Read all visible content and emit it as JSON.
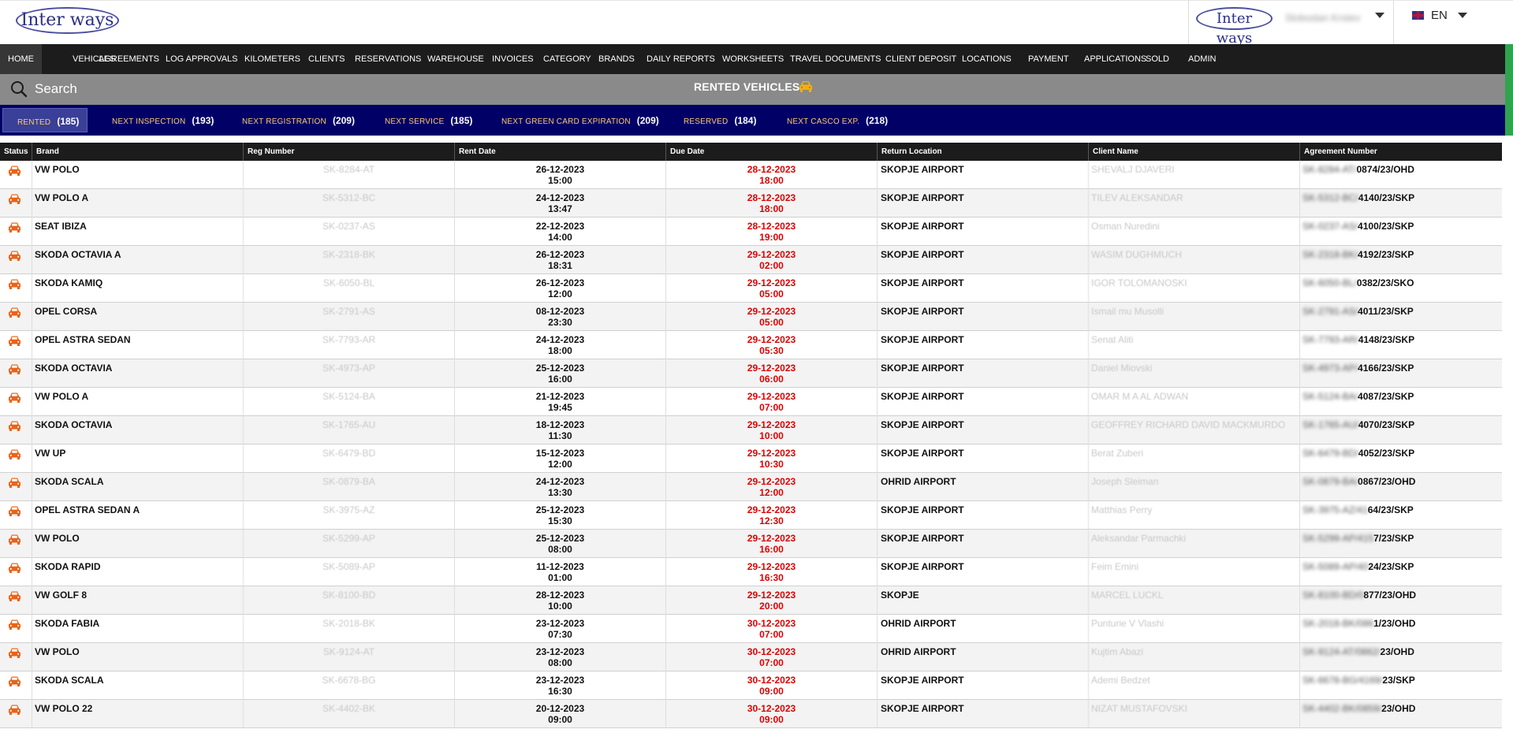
{
  "header": {
    "logo_text": "Inter ways",
    "small_logo_text": "Inter ways",
    "user_name": "Slobodan Krstev",
    "language": "EN"
  },
  "colors": {
    "nav_background": "#1c1c1c",
    "search_bar_background": "#8a8a8a",
    "tabs_background": "#000066",
    "tab_label_color": "#ffcc66",
    "due_date_color": "#dd0000",
    "status_icon_color": "#e8631a",
    "accent_strip": "#2ea44f"
  },
  "nav": {
    "items": [
      {
        "label": "HOME",
        "active": true
      },
      {
        "label": "VEHICLES"
      },
      {
        "label": "AGREEMENTS"
      },
      {
        "label": "LOG APPROVALS"
      },
      {
        "label": "KILOMETERS"
      },
      {
        "label": "CLIENTS"
      },
      {
        "label": "RESERVATIONS"
      },
      {
        "label": "WAREHOUSE"
      },
      {
        "label": "INVOICES"
      },
      {
        "label": "CATEGORY"
      },
      {
        "label": "BRANDS"
      },
      {
        "label": "DAILY REPORTS"
      },
      {
        "label": "WORKSHEETS"
      },
      {
        "label": "TRAVEL DOCUMENTS"
      },
      {
        "label": "CLIENT DEPOSIT"
      },
      {
        "label": "LOCATIONS"
      },
      {
        "label": "PAYMENT"
      },
      {
        "label": "APPLICATIONS"
      },
      {
        "label": "SOLD"
      },
      {
        "label": "ADMIN"
      }
    ]
  },
  "search": {
    "placeholder": "Search",
    "page_title": "RENTED VEHICLES",
    "title_icon": "car-icon"
  },
  "tabs": [
    {
      "label": "RENTED",
      "count": "(185)",
      "active": true
    },
    {
      "label": "NEXT INSPECTION",
      "count": "(193)"
    },
    {
      "label": "NEXT REGISTRATION",
      "count": "(209)"
    },
    {
      "label": "NEXT SERVICE",
      "count": "(185)"
    },
    {
      "label": "NEXT GREEN CARD EXPIRATION",
      "count": "(209)"
    },
    {
      "label": "RESERVED",
      "count": "(184)"
    },
    {
      "label": "NEXT CASCO EXP.",
      "count": "(218)"
    }
  ],
  "table": {
    "columns": [
      "Status",
      "Brand",
      "Reg Number",
      "Rent Date",
      "Due Date",
      "Return Location",
      "Client Name",
      "Agreement Number"
    ],
    "status_icon": "car-icon",
    "rows": [
      {
        "brand": "VW POLO",
        "reg": "SK-8284-AT",
        "rent_date": "26-12-2023",
        "rent_time": "15:00",
        "due_date": "28-12-2023",
        "due_time": "18:00",
        "location": "SKOPJE AIRPORT",
        "client": "SHEVALJ DJAVERI",
        "agr_hidden": "SK-8284-AT/",
        "agr_visible": "0874/23/OHD"
      },
      {
        "brand": "VW POLO A",
        "reg": "SK-5312-BC",
        "rent_date": "24-12-2023",
        "rent_time": "13:47",
        "due_date": "28-12-2023",
        "due_time": "18:00",
        "location": "SKOPJE AIRPORT",
        "client": "TILEV ALEKSANDAR",
        "agr_hidden": "SK-5312-BC/",
        "agr_visible": "4140/23/SKP"
      },
      {
        "brand": "SEAT IBIZA",
        "reg": "SK-0237-AS",
        "rent_date": "22-12-2023",
        "rent_time": "14:00",
        "due_date": "28-12-2023",
        "due_time": "19:00",
        "location": "SKOPJE AIRPORT",
        "client": "Osman Nuredini",
        "agr_hidden": "SK-0237-AS/",
        "agr_visible": "4100/23/SKP"
      },
      {
        "brand": "SKODA OCTAVIA A",
        "reg": "SK-2318-BK",
        "rent_date": "26-12-2023",
        "rent_time": "18:31",
        "due_date": "29-12-2023",
        "due_time": "02:00",
        "location": "SKOPJE AIRPORT",
        "client": "WASIM DUGHMUCH",
        "agr_hidden": "SK-2318-BK/",
        "agr_visible": "4192/23/SKP"
      },
      {
        "brand": "SKODA KAMIQ",
        "reg": "SK-6050-BL",
        "rent_date": "26-12-2023",
        "rent_time": "12:00",
        "due_date": "29-12-2023",
        "due_time": "05:00",
        "location": "SKOPJE AIRPORT",
        "client": "IGOR TOLOMANOSKI",
        "agr_hidden": "SK-6050-BL/",
        "agr_visible": "0382/23/SKO"
      },
      {
        "brand": "OPEL CORSA",
        "reg": "SK-2791-AS",
        "rent_date": "08-12-2023",
        "rent_time": "23:30",
        "due_date": "29-12-2023",
        "due_time": "05:00",
        "location": "SKOPJE AIRPORT",
        "client": "Ismail mu Musolli",
        "agr_hidden": "SK-2791-AS/",
        "agr_visible": "4011/23/SKP"
      },
      {
        "brand": "OPEL ASTRA SEDAN",
        "reg": "SK-7793-AR",
        "rent_date": "24-12-2023",
        "rent_time": "18:00",
        "due_date": "29-12-2023",
        "due_time": "05:30",
        "location": "SKOPJE AIRPORT",
        "client": "Senat Aliti",
        "agr_hidden": "SK-7793-AR/",
        "agr_visible": "4148/23/SKP"
      },
      {
        "brand": "SKODA OCTAVIA",
        "reg": "SK-4973-AP",
        "rent_date": "25-12-2023",
        "rent_time": "16:00",
        "due_date": "29-12-2023",
        "due_time": "06:00",
        "location": "SKOPJE AIRPORT",
        "client": "Daniel Miovski",
        "agr_hidden": "SK-4973-AP/",
        "agr_visible": "4166/23/SKP"
      },
      {
        "brand": "VW POLO A",
        "reg": "SK-5124-BA",
        "rent_date": "21-12-2023",
        "rent_time": "19:45",
        "due_date": "29-12-2023",
        "due_time": "07:00",
        "location": "SKOPJE AIRPORT",
        "client": "OMAR M A AL ADWAN",
        "agr_hidden": "SK-5124-BA/",
        "agr_visible": "4087/23/SKP"
      },
      {
        "brand": "SKODA OCTAVIA",
        "reg": "SK-1765-AU",
        "rent_date": "18-12-2023",
        "rent_time": "11:30",
        "due_date": "29-12-2023",
        "due_time": "10:00",
        "location": "SKOPJE AIRPORT",
        "client": "GEOFFREY RICHARD DAVID MACKMURDO",
        "agr_hidden": "SK-1765-AU/",
        "agr_visible": "4070/23/SKP"
      },
      {
        "brand": "VW UP",
        "reg": "SK-6479-BD",
        "rent_date": "15-12-2023",
        "rent_time": "12:00",
        "due_date": "29-12-2023",
        "due_time": "10:30",
        "location": "SKOPJE AIRPORT",
        "client": "Berat Zuberi",
        "agr_hidden": "SK-6479-BD/",
        "agr_visible": "4052/23/SKP"
      },
      {
        "brand": "SKODA SCALA",
        "reg": "SK-0879-BA",
        "rent_date": "24-12-2023",
        "rent_time": "13:30",
        "due_date": "29-12-2023",
        "due_time": "12:00",
        "location": "OHRID AIRPORT",
        "client": "Joseph Sleiman",
        "agr_hidden": "SK-0879-BA/",
        "agr_visible": "0867/23/OHD"
      },
      {
        "brand": "OPEL ASTRA SEDAN A",
        "reg": "SK-3975-AZ",
        "rent_date": "25-12-2023",
        "rent_time": "15:30",
        "due_date": "29-12-2023",
        "due_time": "12:30",
        "location": "SKOPJE AIRPORT",
        "client": "Matthias Perry",
        "agr_hidden": "SK-3975-AZ/41",
        "agr_visible": "64/23/SKP"
      },
      {
        "brand": "VW POLO",
        "reg": "SK-5299-AP",
        "rent_date": "25-12-2023",
        "rent_time": "08:00",
        "due_date": "29-12-2023",
        "due_time": "16:00",
        "location": "SKOPJE AIRPORT",
        "client": "Aleksandar Parmachki",
        "agr_hidden": "SK-5299-AP/415",
        "agr_visible": "7/23/SKP"
      },
      {
        "brand": "SKODA RAPID",
        "reg": "SK-5089-AP",
        "rent_date": "11-12-2023",
        "rent_time": "01:00",
        "due_date": "29-12-2023",
        "due_time": "16:30",
        "location": "SKOPJE AIRPORT",
        "client": "Feim Emini",
        "agr_hidden": "SK-5089-AP/40",
        "agr_visible": "24/23/SKP"
      },
      {
        "brand": "VW GOLF 8",
        "reg": "SK-8100-BD",
        "rent_date": "28-12-2023",
        "rent_time": "10:00",
        "due_date": "29-12-2023",
        "due_time": "20:00",
        "location": "SKOPJE",
        "client": "MARCEL LUCKL",
        "agr_hidden": "SK-8100-BD/0",
        "agr_visible": "877/23/OHD"
      },
      {
        "brand": "SKODA FABIA",
        "reg": "SK-2018-BK",
        "rent_date": "23-12-2023",
        "rent_time": "07:30",
        "due_date": "30-12-2023",
        "due_time": "07:00",
        "location": "OHRID AIRPORT",
        "client": "Punturie V Vlashi",
        "agr_hidden": "SK-2018-BK/086",
        "agr_visible": "1/23/OHD"
      },
      {
        "brand": "VW POLO",
        "reg": "SK-9124-AT",
        "rent_date": "23-12-2023",
        "rent_time": "08:00",
        "due_date": "30-12-2023",
        "due_time": "07:00",
        "location": "OHRID AIRPORT",
        "client": "Kujtim Abazi",
        "agr_hidden": "SK-9124-AT/0862/",
        "agr_visible": "23/OHD"
      },
      {
        "brand": "SKODA SCALA",
        "reg": "SK-6678-BG",
        "rent_date": "23-12-2023",
        "rent_time": "16:30",
        "due_date": "30-12-2023",
        "due_time": "09:00",
        "location": "SKOPJE AIRPORT",
        "client": "Ademi Bedzet",
        "agr_hidden": "SK-6678-BG/4169/",
        "agr_visible": "23/SKP"
      },
      {
        "brand": "VW POLO 22",
        "reg": "SK-4402-BK",
        "rent_date": "20-12-2023",
        "rent_time": "09:00",
        "due_date": "30-12-2023",
        "due_time": "09:00",
        "location": "SKOPJE AIRPORT",
        "client": "NIZAT MUSTAFOVSKI",
        "agr_hidden": "SK-4402-BK/0859/",
        "agr_visible": "23/OHD"
      }
    ]
  }
}
